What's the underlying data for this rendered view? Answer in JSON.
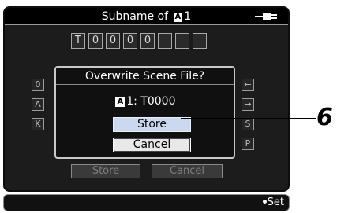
{
  "header": {
    "title_prefix": "Subname of",
    "slot_badge": "A",
    "slot_number": "1",
    "power_icon": "ac-plug-icon"
  },
  "name_chars": [
    "T",
    "0",
    "0",
    "0",
    "0",
    "",
    "",
    ""
  ],
  "keyboard_left": [
    "0",
    "A",
    "K"
  ],
  "keyboard_right": [
    "←",
    "→",
    "S",
    "P"
  ],
  "background_buttons": {
    "store_label": "Store",
    "cancel_label": "Cancel"
  },
  "dialog": {
    "title": "Overwrite Scene File?",
    "slot_badge": "A",
    "info_text": "1: T0000",
    "store_label": "Store",
    "cancel_label": "Cancel"
  },
  "footer": {
    "set_label": "Set"
  },
  "callout": {
    "number": "6"
  },
  "colors": {
    "screen_bg": "#1c1c1c",
    "selected_button": "#c9d9f0",
    "text": "#ffffff"
  }
}
